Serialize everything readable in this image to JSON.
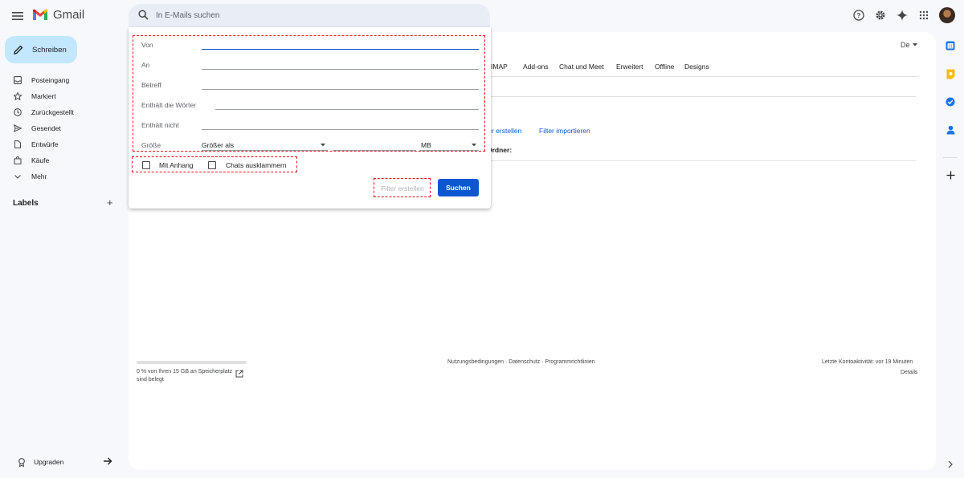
{
  "header": {
    "app_name": "Gmail",
    "search_placeholder": "In E-Mails suchen"
  },
  "nav": {
    "compose_label": "Schreiben",
    "items": [
      {
        "label": "Posteingang",
        "icon": "inbox-icon"
      },
      {
        "label": "Markiert",
        "icon": "star-icon"
      },
      {
        "label": "Zurückgestellt",
        "icon": "clock-icon"
      },
      {
        "label": "Gesendet",
        "icon": "send-icon"
      },
      {
        "label": "Entwürfe",
        "icon": "draft-icon"
      },
      {
        "label": "Käufe",
        "icon": "shopping-icon"
      },
      {
        "label": "Mehr",
        "icon": "chevron-down-icon"
      }
    ],
    "labels_title": "Labels",
    "labels_add": "+",
    "upgrade_label": "Upgraden"
  },
  "settings": {
    "lang_short": "De",
    "tabs": [
      "P/IMAP",
      "Add-ons",
      "Chat und Meet",
      "Erweitert",
      "Offline",
      "Designs"
    ],
    "link_create": "lter erstellen",
    "link_import": "Filter importieren",
    "folder_label": "Ordner:"
  },
  "search_panel": {
    "fields": [
      {
        "label": "Von",
        "value": ""
      },
      {
        "label": "An",
        "value": ""
      },
      {
        "label": "Betreff",
        "value": ""
      },
      {
        "label": "Enthält die Wörter",
        "value": ""
      },
      {
        "label": "Enthält nicht",
        "value": ""
      }
    ],
    "size_label": "Größe",
    "size_operator": "Größer als",
    "size_value": "",
    "size_unit": "MB",
    "checkbox_attachment": "Mit Anhang",
    "checkbox_chats": "Chats ausklammern",
    "filter_button": "Filter erstellen",
    "search_button": "Suchen"
  },
  "footer": {
    "storage_text": "0 % von Ihren 15 GB an Speicherplatz sind belegt",
    "storage_used_fraction": 0.0,
    "links": "Nutzungsbedingungen · Datenschutz · Programmrichtlinien",
    "last_activity": "Letzte Kontoaktivität: vor 19 Minuten",
    "details": "Details"
  },
  "colors": {
    "accent": "#0b57d0",
    "compose_bg": "#c2e7ff",
    "highlight": "#e0151b",
    "page_bg": "#f6f8fc"
  }
}
